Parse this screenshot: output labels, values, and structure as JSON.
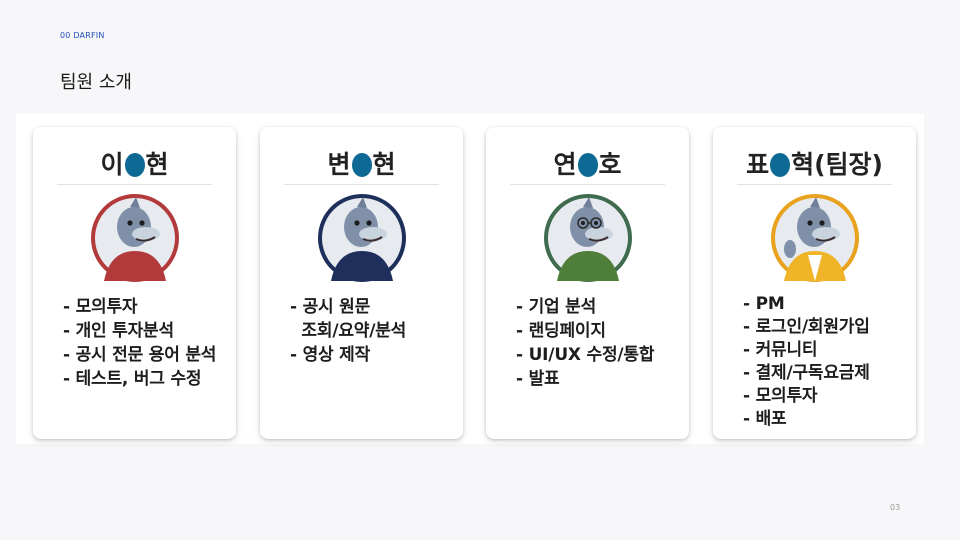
{
  "section_tag": "00 DARFIN",
  "title": "팀원 소개",
  "page_number": "03",
  "members": [
    {
      "name_start": "이",
      "name_end": "현",
      "avatar_color": "#b23a3a",
      "roles": [
        "- 모의투자",
        "- 개인 투자분석",
        "- 공시 전문 용어 분석",
        "- 테스트, 버그 수정"
      ]
    },
    {
      "name_start": "변",
      "name_end": "현",
      "avatar_color": "#1f2f5c",
      "roles": [
        "- 공시 원문",
        "  조회/요약/분석",
        "- 영상 제작"
      ]
    },
    {
      "name_start": "연",
      "name_end": "호",
      "avatar_color": "#3f6b4f",
      "roles": [
        "- 기업 분석",
        "- 랜딩페이지",
        "- UI/UX 수정/통합",
        "- 발표"
      ]
    },
    {
      "name_start": "표",
      "name_end": "혁(팀장)",
      "avatar_color": "#e8a21e",
      "roles": [
        "- PM",
        "- 로그인/회원가입",
        "- 커뮤니티",
        "- 결제/구독요금제",
        "- 모의투자",
        "- 배포"
      ]
    }
  ]
}
